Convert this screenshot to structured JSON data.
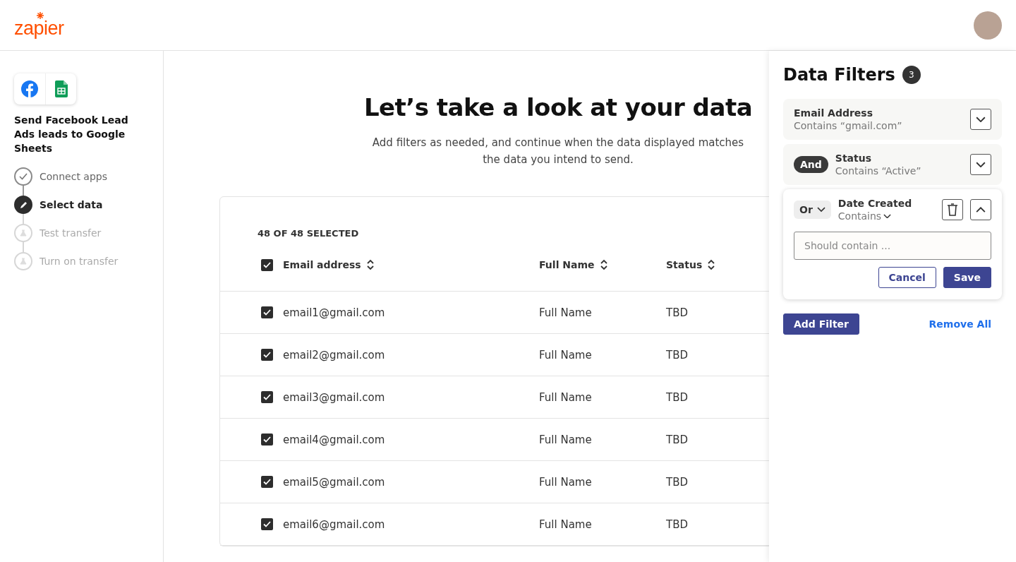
{
  "header": {
    "logo": "zapier"
  },
  "sidebar": {
    "title": "Send Facebook Lead Ads leads to Google Sheets",
    "steps": [
      {
        "label": "Connect apps",
        "completed": true,
        "selected": false
      },
      {
        "label": "Select data",
        "completed": false,
        "selected": true
      },
      {
        "label": "Test transfer",
        "completed": false,
        "selected": false
      },
      {
        "label": "Turn on transfer",
        "completed": false,
        "selected": false
      }
    ]
  },
  "main": {
    "heading": "Let’s take a look at your data",
    "subtitle": "Add filters as needed, and continue when the data displayed matches the data you intend to send.",
    "table": {
      "selection_count": "48 OF 48 SELECTED",
      "all_checked": true,
      "columns": [
        "Email address",
        "Full Name",
        "Status"
      ],
      "rows": [
        {
          "checked": true,
          "cells": [
            "email1@gmail.com",
            "Full Name",
            "TBD"
          ]
        },
        {
          "checked": true,
          "cells": [
            "email2@gmail.com",
            "Full Name",
            "TBD"
          ]
        },
        {
          "checked": true,
          "cells": [
            "email3@gmail.com",
            "Full Name",
            "TBD"
          ]
        },
        {
          "checked": true,
          "cells": [
            "email4@gmail.com",
            "Full Name",
            "TBD"
          ]
        },
        {
          "checked": true,
          "cells": [
            "email5@gmail.com",
            "Full Name",
            "TBD"
          ]
        },
        {
          "checked": true,
          "cells": [
            "email6@gmail.com",
            "Full Name",
            "TBD"
          ]
        }
      ]
    }
  },
  "filters_panel": {
    "title": "Data Filters",
    "count": "3",
    "filters": [
      {
        "field": "Email Address",
        "condition": "Contains “gmail.com”",
        "expanded": false
      },
      {
        "connector": "And",
        "connector_menu": false,
        "field": "Status",
        "condition": "Contains “Active”",
        "expanded": false
      },
      {
        "connector": "Or",
        "connector_menu": true,
        "field": "Date Created",
        "condition": "Contains",
        "expanded": true,
        "input": {
          "placeholder": "Should contain ..."
        },
        "buttons": [
          "Cancel",
          "Save"
        ]
      }
    ],
    "add_button": "Add Filter",
    "remove_all": "Remove All"
  }
}
